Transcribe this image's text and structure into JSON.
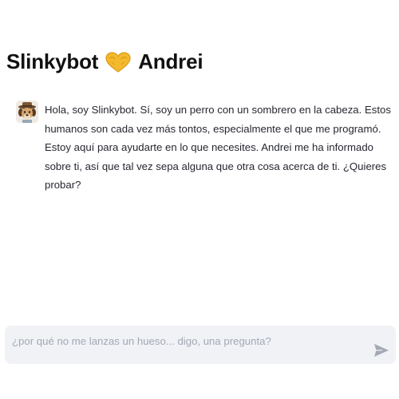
{
  "header": {
    "title_part1": "Slinkybot",
    "title_icon": "yellow-heart-hands-emoji",
    "title_part2": "Andrei"
  },
  "messages": [
    {
      "role": "assistant",
      "avatar_icon": "dog-with-hat-avatar",
      "text": "Hola, soy Slinkybot. Sí, soy un perro con un sombrero en la cabeza. Estos humanos son cada vez más tontos, especialmente el que me programó. Estoy aquí para ayudarte en lo que necesites. Andrei me ha informado sobre ti, así que tal vez sepa alguna que otra cosa acerca de ti. ¿Quieres probar?"
    }
  ],
  "chat_input": {
    "placeholder": "¿por qué no me lanzas un hueso... digo, una pregunta?",
    "value": "",
    "send_icon": "send-arrow-icon"
  },
  "colors": {
    "heart": "#f5b92e",
    "input_bg": "#f0f2f6",
    "send_icon": "#a3a8b4"
  }
}
